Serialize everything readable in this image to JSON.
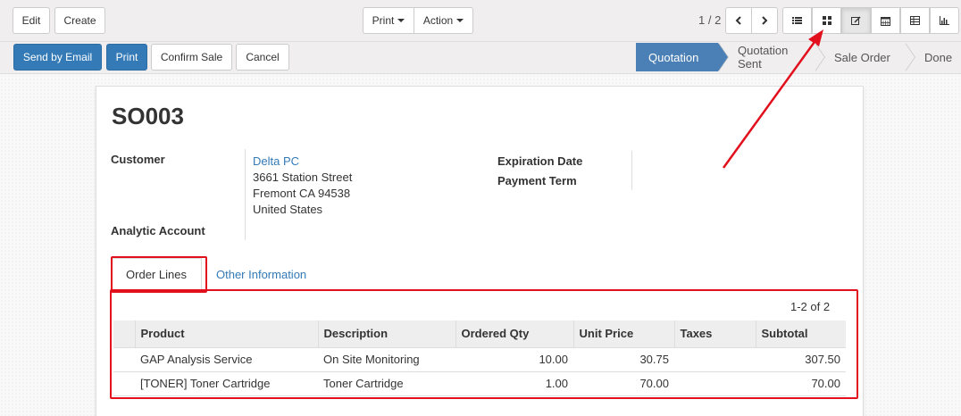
{
  "toolbar": {
    "edit_label": "Edit",
    "create_label": "Create",
    "print_label": "Print",
    "action_label": "Action",
    "pager": "1 / 2"
  },
  "actions": {
    "send_email_label": "Send by Email",
    "print_label": "Print",
    "confirm_label": "Confirm Sale",
    "cancel_label": "Cancel"
  },
  "status_stages": [
    "Quotation",
    "Quotation Sent",
    "Sale Order",
    "Done"
  ],
  "record": {
    "name": "SO003",
    "customer_label": "Customer",
    "customer_name": "Delta PC",
    "address_line1": "3661 Station Street",
    "address_line2": "Fremont CA 94538",
    "address_line3": "United States",
    "analytic_label": "Analytic Account",
    "expiration_label": "Expiration Date",
    "payment_term_label": "Payment Term"
  },
  "tabs": [
    "Order Lines",
    "Other Information"
  ],
  "order_lines": {
    "count": "1-2 of 2",
    "columns": [
      "Product",
      "Description",
      "Ordered Qty",
      "Unit Price",
      "Taxes",
      "Subtotal"
    ],
    "rows": [
      {
        "product": "GAP Analysis Service",
        "description": "On Site Monitoring",
        "qty": "10.00",
        "price": "30.75",
        "taxes": "",
        "subtotal": "307.50"
      },
      {
        "product": "[TONER] Toner Cartridge",
        "description": "Toner Cartridge",
        "qty": "1.00",
        "price": "70.00",
        "taxes": "",
        "subtotal": "70.00"
      }
    ]
  },
  "colors": {
    "primary": "#337ab7",
    "active_stage": "#4b80b6",
    "highlight": "#e2101d",
    "link": "#337ab7"
  },
  "icons": [
    "chevron-left-icon",
    "chevron-right-icon",
    "list-view-icon",
    "kanban-view-icon",
    "form-view-icon",
    "calendar-view-icon",
    "pivot-view-icon",
    "graph-view-icon"
  ]
}
